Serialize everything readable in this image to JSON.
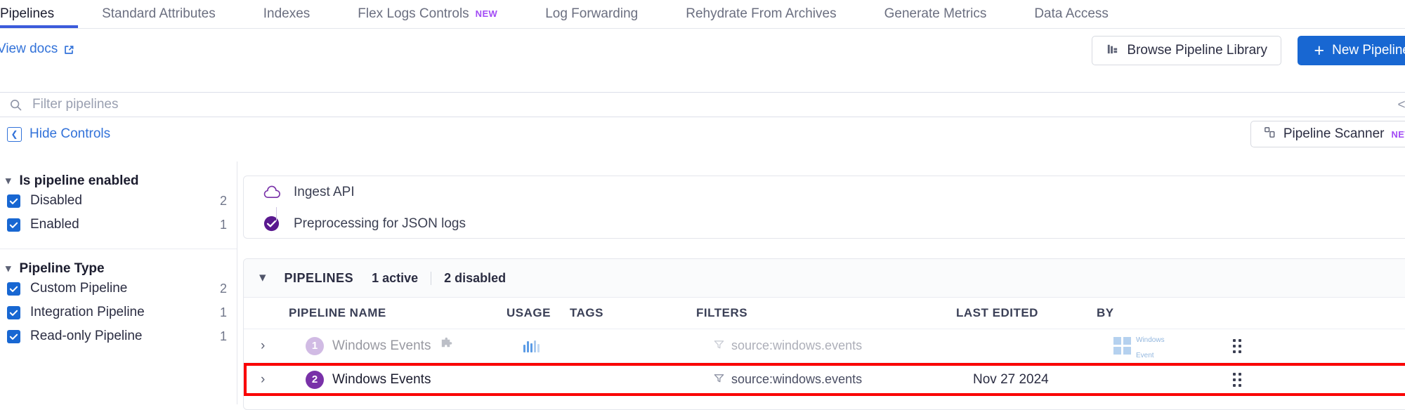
{
  "nav": {
    "tabs": [
      {
        "label": "Pipelines",
        "active": true,
        "badge": ""
      },
      {
        "label": "Standard Attributes",
        "active": false,
        "badge": ""
      },
      {
        "label": "Indexes",
        "active": false,
        "badge": ""
      },
      {
        "label": "Flex Logs Controls",
        "active": false,
        "badge": "NEW"
      },
      {
        "label": "Log Forwarding",
        "active": false,
        "badge": ""
      },
      {
        "label": "Rehydrate From Archives",
        "active": false,
        "badge": ""
      },
      {
        "label": "Generate Metrics",
        "active": false,
        "badge": ""
      },
      {
        "label": "Data Access",
        "active": false,
        "badge": ""
      }
    ]
  },
  "actions": {
    "view_docs": "View docs",
    "browse_library": "Browse Pipeline Library",
    "new_pipeline": "New Pipeline",
    "new_pipeline_plus": "+"
  },
  "search": {
    "placeholder": "Filter pipelines",
    "value": "",
    "code_toggle": "</>"
  },
  "controls": {
    "hide_controls": "Hide Controls",
    "pipeline_scanner": "Pipeline Scanner",
    "pipeline_scanner_badge": "NEW"
  },
  "facets": [
    {
      "title": "Is pipeline enabled",
      "options": [
        {
          "label": "Disabled",
          "count": "2",
          "checked": true
        },
        {
          "label": "Enabled",
          "count": "1",
          "checked": true
        }
      ]
    },
    {
      "title": "Pipeline Type",
      "options": [
        {
          "label": "Custom Pipeline",
          "count": "2",
          "checked": true
        },
        {
          "label": "Integration Pipeline",
          "count": "1",
          "checked": true
        },
        {
          "label": "Read-only Pipeline",
          "count": "1",
          "checked": true
        }
      ]
    }
  ],
  "preprocessing": {
    "rows": [
      {
        "label": "Ingest API",
        "icon": "cloud-icon"
      },
      {
        "label": "Preprocessing for JSON logs",
        "icon": "check-circle-icon"
      }
    ]
  },
  "pipelines_panel": {
    "title": "PIPELINES",
    "active_count": "1 active",
    "disabled_count": "2 disabled",
    "columns": {
      "name": "PIPELINE NAME",
      "usage": "USAGE",
      "tags": "TAGS",
      "filters": "FILTERS",
      "last_edited": "LAST EDITED",
      "by": "BY"
    },
    "rows": [
      {
        "number": "1",
        "number_color": "#9a69c4",
        "name": "Windows Events",
        "has_integration_icon": true,
        "usage_bars": [
          10,
          14,
          12,
          16,
          11
        ],
        "tags": "",
        "filters": "source:windows.events",
        "last_edited": "",
        "by_logo": "Windows Event",
        "by_logo_line1": "Windows",
        "by_logo_line2": "Event",
        "enabled": false,
        "dimmed": true,
        "highlighted": false
      },
      {
        "number": "2",
        "number_color": "#7931a8",
        "name": "Windows Events",
        "has_integration_icon": false,
        "usage_bars": [],
        "tags": "",
        "filters": "source:windows.events",
        "last_edited": "Nov 27 2024",
        "by_logo": "",
        "enabled": true,
        "dimmed": false,
        "highlighted": true
      }
    ]
  },
  "colors": {
    "accent_blue": "#1867d2",
    "link_blue": "#3272d9",
    "purple": "#7931a8",
    "new_badge": "#a24bf5",
    "highlight_red": "#fa0000"
  }
}
